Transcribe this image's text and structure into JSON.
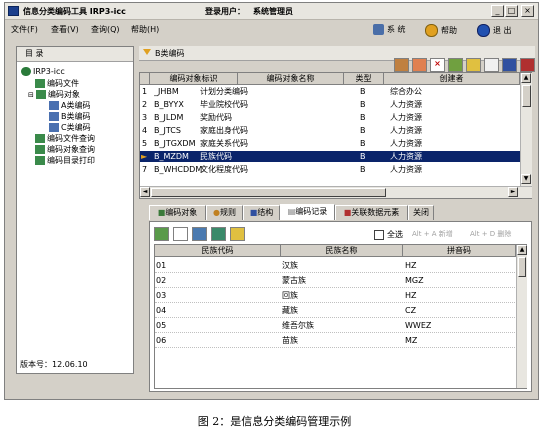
{
  "window": {
    "title": "信息分类编码工具 IRP3-icc",
    "login_label": "登录用户：",
    "login_user": "系统管理员",
    "controls": [
      "_",
      "□",
      "×"
    ]
  },
  "menu": {
    "items": [
      "文件(F)",
      "查看(V)",
      "查询(Q)",
      "帮助(H)"
    ],
    "right_buttons": [
      "系 统",
      "帮助",
      "退 出"
    ]
  },
  "left_panel": {
    "header": "目 录",
    "tree": [
      {
        "label": "IRP3-icc",
        "level": 0
      },
      {
        "label": "编码文件",
        "level": 1
      },
      {
        "label": "编码对象",
        "level": 1
      },
      {
        "label": "A类编码",
        "level": 2
      },
      {
        "label": "B类编码",
        "level": 2
      },
      {
        "label": "C类编码",
        "level": 2
      },
      {
        "label": "编码文件查询",
        "level": 1
      },
      {
        "label": "编码对象查询",
        "level": 1
      },
      {
        "label": "编码目录打印",
        "level": 1
      }
    ],
    "version": "版本号：12.06.10"
  },
  "right_panel": {
    "title": "B类编码",
    "columns": [
      "编码对象标识",
      "编码对象名称",
      "类型",
      "创建者"
    ],
    "rows": [
      {
        "num": "1",
        "id": "_JHBM",
        "name": "计划分类编码",
        "type": "B",
        "creator": "综合办公"
      },
      {
        "num": "2",
        "id": "B_BYYX",
        "name": "毕业院校代码",
        "type": "B",
        "creator": "人力资源"
      },
      {
        "num": "3",
        "id": "B_JLDM",
        "name": "奖励代码",
        "type": "B",
        "creator": "人力资源"
      },
      {
        "num": "4",
        "id": "B_JTCS",
        "name": "家庭出身代码",
        "type": "B",
        "creator": "人力资源"
      },
      {
        "num": "5",
        "id": "B_JTGXDM",
        "name": "家庭关系代码",
        "type": "B",
        "creator": "人力资源"
      },
      {
        "num": "6",
        "id": "B_MZDM",
        "name": "民族代码",
        "type": "B",
        "creator": "人力资源"
      },
      {
        "num": "7",
        "id": "B_WHCDDM",
        "name": "文化程度代码",
        "type": "B",
        "creator": "人力资源"
      }
    ],
    "selected_row": 5,
    "tabs": [
      "编码对象",
      "规则",
      "结构",
      "编码记录",
      "关联数据元素",
      "关闭"
    ],
    "active_tab": 3,
    "select_all": "全选",
    "shortcut_add": "Alt + A 新增",
    "shortcut_del": "Alt + D 删除",
    "record_columns": [
      "民族代码",
      "民族名称",
      "拼音码"
    ],
    "records": [
      {
        "code": "01",
        "name": "汉族",
        "py": "HZ"
      },
      {
        "code": "02",
        "name": "蒙古族",
        "py": "MGZ"
      },
      {
        "code": "03",
        "name": "回族",
        "py": "HZ"
      },
      {
        "code": "04",
        "name": "藏族",
        "py": "CZ"
      },
      {
        "code": "05",
        "name": "维吾尔族",
        "py": "WWEZ"
      },
      {
        "code": "06",
        "name": "苗族",
        "py": "MZ"
      }
    ]
  },
  "caption": "图 2：是信息分类编码管理示例"
}
